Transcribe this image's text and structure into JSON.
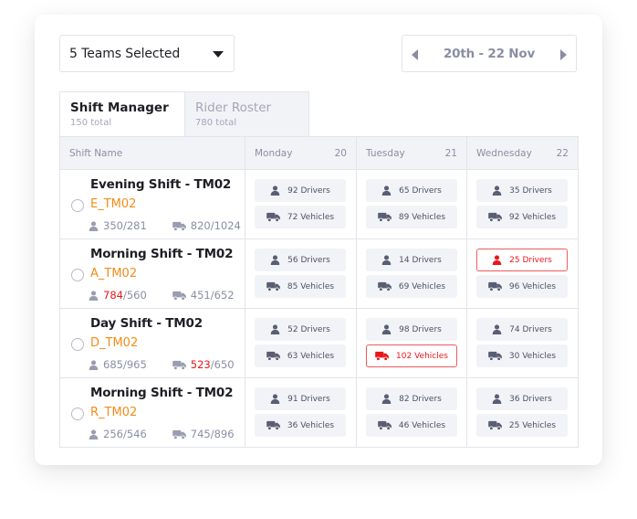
{
  "filters": {
    "team_select_label": "5 Teams Selected",
    "date_range": "20th - 22 Nov"
  },
  "tabs": [
    {
      "title": "Shift Manager",
      "subtitle": "150 total",
      "active": true
    },
    {
      "title": "Rider Roster",
      "subtitle": "780 total",
      "active": false
    }
  ],
  "table": {
    "header_shift": "Shift Name",
    "days": [
      {
        "name": "Monday",
        "date": "20"
      },
      {
        "name": "Tuesday",
        "date": "21"
      },
      {
        "name": "Wednesday",
        "date": "22"
      }
    ],
    "rows": [
      {
        "name": "Evening Shift - TM02",
        "code": "E_TM02",
        "drivers_actual": "350",
        "drivers_total": "/281",
        "drivers_over": false,
        "vehicles_actual": "820",
        "vehicles_total": "/1024",
        "vehicles_over": false,
        "days": [
          {
            "drivers": "92 Drivers",
            "vehicles": "72 Vehicles",
            "drivers_alert": false,
            "vehicles_alert": false
          },
          {
            "drivers": "65 Drivers",
            "vehicles": "89 Vehicles",
            "drivers_alert": false,
            "vehicles_alert": false
          },
          {
            "drivers": "35 Drivers",
            "vehicles": "92 Vehicles",
            "drivers_alert": false,
            "vehicles_alert": false
          }
        ]
      },
      {
        "name": "Morning Shift - TM02",
        "code": "A_TM02",
        "drivers_actual": "784",
        "drivers_total": "/560",
        "drivers_over": true,
        "vehicles_actual": "451",
        "vehicles_total": "/652",
        "vehicles_over": false,
        "days": [
          {
            "drivers": "56 Drivers",
            "vehicles": "85 Vehicles",
            "drivers_alert": false,
            "vehicles_alert": false
          },
          {
            "drivers": "14 Drivers",
            "vehicles": "69 Vehicles",
            "drivers_alert": false,
            "vehicles_alert": false
          },
          {
            "drivers": "25 Drivers",
            "vehicles": "96 Vehicles",
            "drivers_alert": true,
            "vehicles_alert": false
          }
        ]
      },
      {
        "name": "Day Shift - TM02",
        "code": "D_TM02",
        "drivers_actual": "685",
        "drivers_total": "/965",
        "drivers_over": false,
        "vehicles_actual": "523",
        "vehicles_total": "/650",
        "vehicles_over": true,
        "days": [
          {
            "drivers": "52 Drivers",
            "vehicles": "63 Vehicles",
            "drivers_alert": false,
            "vehicles_alert": false
          },
          {
            "drivers": "98 Drivers",
            "vehicles": "102 Vehicles",
            "drivers_alert": false,
            "vehicles_alert": true
          },
          {
            "drivers": "74 Drivers",
            "vehicles": "30 Vehicles",
            "drivers_alert": false,
            "vehicles_alert": false
          }
        ]
      },
      {
        "name": "Morning Shift - TM02",
        "code": "R_TM02",
        "drivers_actual": "256",
        "drivers_total": "/546",
        "drivers_over": false,
        "vehicles_actual": "745",
        "vehicles_total": "/896",
        "vehicles_over": false,
        "days": [
          {
            "drivers": "91 Drivers",
            "vehicles": "36 Vehicles",
            "drivers_alert": false,
            "vehicles_alert": false
          },
          {
            "drivers": "82 Drivers",
            "vehicles": "46 Vehicles",
            "drivers_alert": false,
            "vehicles_alert": false
          },
          {
            "drivers": "36 Drivers",
            "vehicles": "25 Vehicles",
            "drivers_alert": false,
            "vehicles_alert": false
          }
        ]
      }
    ]
  },
  "icons": {
    "driver": "person-icon",
    "vehicle": "truck-icon",
    "prev": "caret-left-icon",
    "next": "caret-right-icon",
    "dropdown": "caret-down-icon"
  },
  "colors": {
    "accent_code": "#f28c18",
    "alert": "#e8171c",
    "muted": "#8a8ea3",
    "pill_bg": "#f2f3f7"
  }
}
